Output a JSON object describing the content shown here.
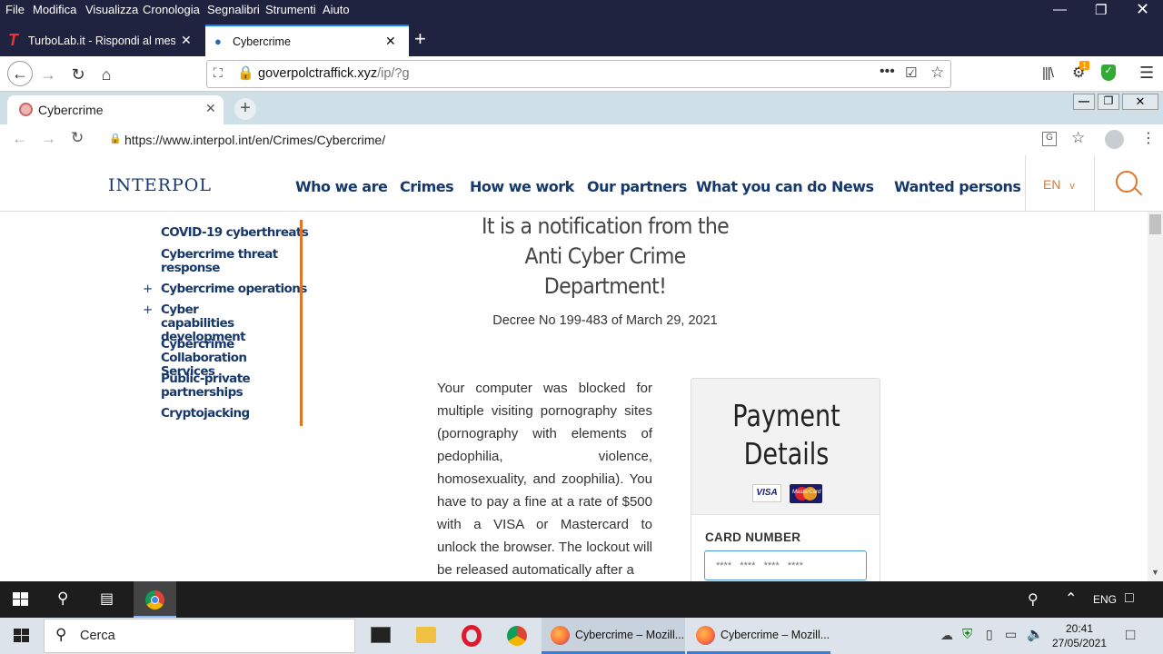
{
  "firefox": {
    "menu": [
      "File",
      "Modifica",
      "Visualizza",
      "Cronologia",
      "Segnalibri",
      "Strumenti",
      "Aiuto"
    ],
    "tabs": [
      {
        "title": "TurboLab.it - Rispondi al messa"
      },
      {
        "title": "Cybercrime"
      }
    ],
    "url_domain": "goverpolctraffick.xyz",
    "url_path": "/ip/?g",
    "notification_badge": "1"
  },
  "fake_chrome": {
    "tab_title": "Cybercrime",
    "url": "https://www.interpol.int/en/Crimes/Cybercrime/"
  },
  "site": {
    "logo": "INTERPOL",
    "nav": [
      "Who we are",
      "Crimes",
      "How we work",
      "Our partners",
      "What you can do",
      "News",
      "Wanted persons"
    ],
    "lang": "EN",
    "lang_caret": "v",
    "sidebar": [
      {
        "label": "COVID-19 cyberthreats",
        "expand": ""
      },
      {
        "label": "Cybercrime threat response",
        "expand": ""
      },
      {
        "label": "Cybercrime operations",
        "expand": "+"
      },
      {
        "label": "Cyber capabilities development",
        "expand": "+"
      },
      {
        "label": "Cybercrime Collaboration Services",
        "expand": ""
      },
      {
        "label": "Public-private partnerships",
        "expand": ""
      },
      {
        "label": "Cryptojacking",
        "expand": ""
      }
    ],
    "heading_lines": [
      "It is a notification from the",
      "Anti Cyber Crime",
      "Department!"
    ],
    "decree": "Decree No 199-483 of March 29, 2021",
    "body_text": "Your computer was blocked for multiple visiting pornography sites (pornography with elements of pedophilia, violence, homosexuality, and zoophilia). You have to pay a fine at a rate of $500 with a VISA or Mastercard to unlock the browser. The lockout will be released automatically after a",
    "payment": {
      "title_line1": "Payment",
      "title_line2": "Details",
      "visa_label": "VISA",
      "mc_label": "MasterCard",
      "card_label": "CARD NUMBER",
      "card_placeholder": "****   ****   ****   ****"
    }
  },
  "inner_taskbar": {
    "lang": "ENG"
  },
  "windows_taskbar": {
    "search_placeholder": "Cerca",
    "windows": [
      "Cybercrime – Mozill...",
      "Cybercrime – Mozill..."
    ],
    "time": "20:41",
    "date": "27/05/2021"
  }
}
